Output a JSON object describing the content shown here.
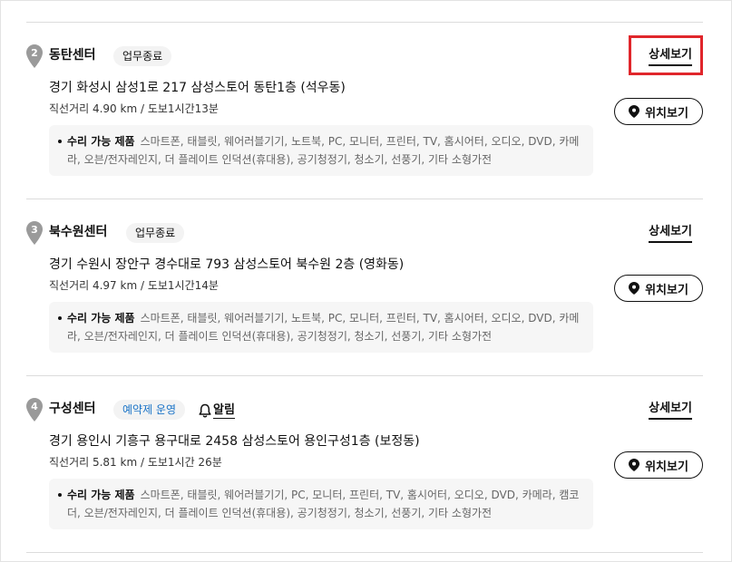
{
  "centers": [
    {
      "number": "2",
      "name": "동탄센터",
      "status": "업무종료",
      "address": "경기 화성시 삼성1로 217 삼성스토어 동탄1층 (석우동)",
      "distance": "직선거리 4.90 km / 도보1시간13분",
      "repair_label": "수리 가능 제품",
      "repair_items": "스마트폰, 태블릿, 웨어러블기기, 노트북, PC, 모니터, 프린터, TV, 홈시어터, 오디오, DVD, 카메라, 오븐/전자레인지, 더 플레이트 인덕션(휴대용), 공기청정기, 청소기, 선풍기, 기타 소형가전"
    },
    {
      "number": "3",
      "name": "북수원센터",
      "status": "업무종료",
      "address": "경기 수원시 장안구 경수대로 793 삼성스토어 북수원 2층 (영화동)",
      "distance": "직선거리 4.97 km / 도보1시간14분",
      "repair_label": "수리 가능 제품",
      "repair_items": "스마트폰, 태블릿, 웨어러블기기, 노트북, PC, 모니터, 프린터, TV, 홈시어터, 오디오, DVD, 카메라, 오븐/전자레인지, 더 플레이트 인덕션(휴대용), 공기청정기, 청소기, 선풍기, 기타 소형가전"
    },
    {
      "number": "4",
      "name": "구성센터",
      "status": "예약제 운영",
      "alarm": "알림",
      "address": "경기 용인시 기흥구 용구대로 2458 삼성스토어 용인구성1층 (보정동)",
      "distance": "직선거리 5.81 km / 도보1시간 26분",
      "repair_label": "수리 가능 제품",
      "repair_items": "스마트폰, 태블릿, 웨어러블기기, PC, 모니터, 프린터, TV, 홈시어터, 오디오, DVD, 카메라, 캠코더, 오븐/전자레인지, 더 플레이트 인덕션(휴대용), 공기청정기, 청소기, 선풍기, 기타 소형가전"
    }
  ],
  "labels": {
    "detail": "상세보기",
    "location": "위치보기"
  },
  "colors": {
    "highlight_border": "#e0262b",
    "reservation_text": "#1a73c7",
    "pin": "#9a9a9a"
  }
}
